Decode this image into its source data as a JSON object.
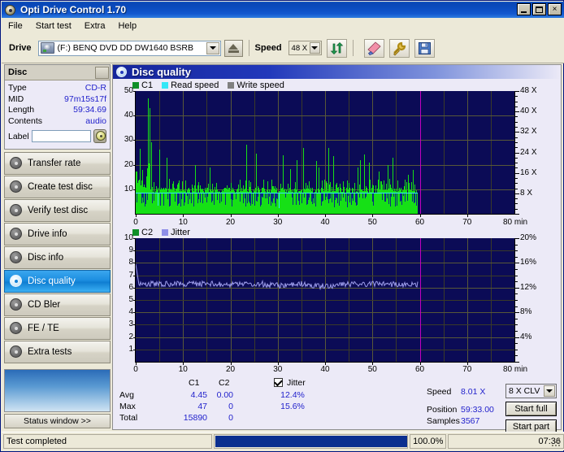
{
  "window": {
    "title": "Opti Drive Control 1.70",
    "icon": "disc-icon",
    "minimize": "minimize-icon",
    "maximize": "maximize-icon",
    "close": "×"
  },
  "menu": {
    "items": [
      {
        "label": "File"
      },
      {
        "label": "Start test"
      },
      {
        "label": "Extra"
      },
      {
        "label": "Help"
      }
    ]
  },
  "toolbar": {
    "drive_label": "Drive",
    "drive_value": "(F:)   BENQ DVD DD DW1640 BSRB",
    "eject_icon": "eject-icon",
    "speed_label": "Speed",
    "speed_value": "48 X",
    "refresh_icon": "refresh-icon",
    "erase_icon": "eraser-icon",
    "tools_icon": "tools-icon",
    "save_icon": "save-icon"
  },
  "disc_panel": {
    "header": "Disc",
    "rows": [
      {
        "key": "Type",
        "value": "CD-R"
      },
      {
        "key": "MID",
        "value": "97m15s17f"
      },
      {
        "key": "Length",
        "value": "59:34.69"
      },
      {
        "key": "Contents",
        "value": "audio"
      }
    ],
    "label_key": "Label",
    "label_value": "",
    "label_placeholder": "",
    "cd_icon": "cd-icon"
  },
  "sidebar": {
    "items": [
      {
        "label": "Transfer rate",
        "icon": "disc-transfer-icon",
        "selected": false
      },
      {
        "label": "Create test disc",
        "icon": "disc-create-icon",
        "selected": false
      },
      {
        "label": "Verify test disc",
        "icon": "disc-verify-icon",
        "selected": false
      },
      {
        "label": "Drive info",
        "icon": "disc-drive-icon",
        "selected": false
      },
      {
        "label": "Disc info",
        "icon": "disc-info-icon",
        "selected": false
      },
      {
        "label": "Disc quality",
        "icon": "disc-quality-icon",
        "selected": true
      },
      {
        "label": "CD Bler",
        "icon": "disc-bler-icon",
        "selected": false
      },
      {
        "label": "FE / TE",
        "icon": "disc-fete-icon",
        "selected": false
      },
      {
        "label": "Extra tests",
        "icon": "disc-extra-icon",
        "selected": false
      }
    ],
    "status_window_button": "Status window >>"
  },
  "main": {
    "title": "Disc quality",
    "icon": "disc-quality-icon"
  },
  "chart_data": [
    {
      "type": "bar",
      "title": "C1 errors vs read speed",
      "xlabel": "80 min",
      "ylabel": "",
      "xlim": [
        0,
        80
      ],
      "ylim": [
        0,
        50
      ],
      "grid": true,
      "legend_position": "top-left",
      "legend": [
        {
          "name": "C1",
          "color": "#0f8f28"
        },
        {
          "name": "Read speed",
          "color": "#33e7f7"
        },
        {
          "name": "Write speed",
          "color": "#808080"
        }
      ],
      "xticks": [
        0,
        10,
        20,
        30,
        40,
        50,
        60,
        70,
        80
      ],
      "yticks_left": [
        10,
        20,
        30,
        40,
        50
      ],
      "yticks_right": [
        "8 X",
        "16 X",
        "24 X",
        "32 X",
        "40 X",
        "48 X"
      ],
      "right_axis_label": "80 min",
      "data_end_minutes": 59.55,
      "marker_minutes": 60,
      "series": [
        {
          "name": "C1",
          "units": "errors/s",
          "avg": 4.45,
          "max": 47,
          "total": 15890
        },
        {
          "name": "Read speed",
          "units": "X",
          "value": 8.01,
          "constant_from": 0.6
        }
      ]
    },
    {
      "type": "line",
      "title": "C2 errors and jitter",
      "xlabel": "80 min",
      "ylabel": "",
      "xlim": [
        0,
        80
      ],
      "ylim": [
        0,
        10
      ],
      "grid": true,
      "legend_position": "top-left",
      "legend": [
        {
          "name": "C2",
          "color": "#0f8f28"
        },
        {
          "name": "Jitter",
          "color": "#8f8fe8"
        }
      ],
      "xticks": [
        0,
        10,
        20,
        30,
        40,
        50,
        60,
        70,
        80
      ],
      "yticks_left": [
        1,
        2,
        3,
        4,
        5,
        6,
        7,
        8,
        9,
        10
      ],
      "yticks_right": [
        "4%",
        "8%",
        "12%",
        "16%",
        "20%"
      ],
      "right_axis_label": "80 min",
      "data_end_minutes": 59.55,
      "marker_minutes": 60,
      "series": [
        {
          "name": "C2",
          "avg": 0.0,
          "max": 0,
          "total": 0
        },
        {
          "name": "Jitter",
          "avg_percent": "12.4%",
          "max_percent": "15.6%",
          "baseline_value": 6.2,
          "start_value": 7.9
        }
      ]
    }
  ],
  "results": {
    "col_headers": [
      "C1",
      "C2"
    ],
    "row_labels": [
      "Avg",
      "Max",
      "Total"
    ],
    "c1": [
      "4.45",
      "47",
      "15890"
    ],
    "c2": [
      "0.00",
      "0",
      "0"
    ],
    "jitter_label": "Jitter",
    "jitter_checked": true,
    "jitter_avg": "12.4%",
    "jitter_max": "15.6%",
    "speed_label": "Speed",
    "speed_value": "8.01 X",
    "position_label": "Position",
    "position_value": "59:33.00",
    "samples_label": "Samples",
    "samples_value": "3567",
    "write_mode_value": "8 X CLV",
    "start_full_button": "Start full",
    "start_part_button": "Start part"
  },
  "statusbar": {
    "message": "Test completed",
    "progress_percent": "100.0%",
    "progress_value": 100,
    "elapsed": "07:36"
  }
}
